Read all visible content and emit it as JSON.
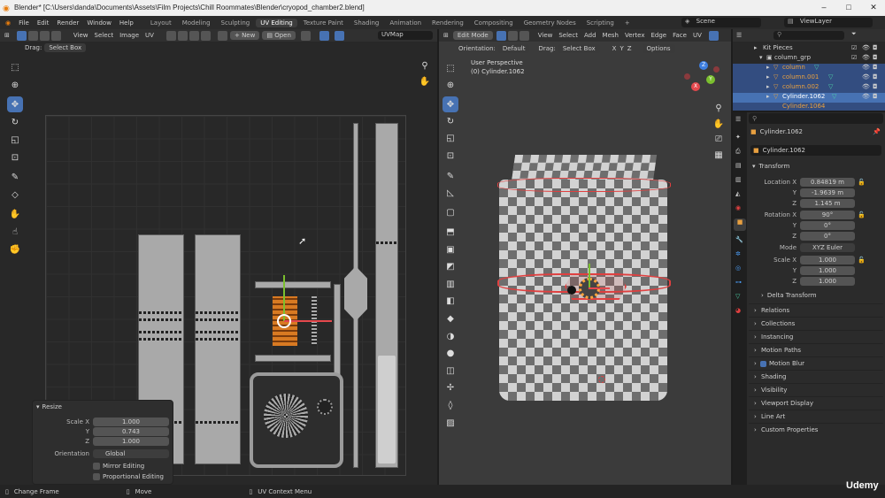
{
  "window": {
    "title": "Blender* [C:\\Users\\danda\\Documents\\Assets\\Film Projects\\Chill Roommates\\Blender\\cryopod_chamber2.blend]",
    "minimize": "–",
    "maximize": "□",
    "close": "✕"
  },
  "menus": [
    "File",
    "Edit",
    "Render",
    "Window",
    "Help"
  ],
  "workspaces": [
    "Layout",
    "Modeling",
    "Sculpting",
    "UV Editing",
    "Texture Paint",
    "Shading",
    "Animation",
    "Rendering",
    "Compositing",
    "Geometry Nodes",
    "Scripting"
  ],
  "workspace_add": "+",
  "scene": {
    "label": "Scene",
    "view_layer": "ViewLayer"
  },
  "uv_editor": {
    "header": {
      "view": "View",
      "select": "Select",
      "image": "Image",
      "uv": "UV",
      "new": "New",
      "open": "Open",
      "uvmap": "UVMap"
    },
    "drag_label": "Drag:",
    "drag_value": "Select Box",
    "resize_panel": {
      "title": "Resize",
      "scale_x_label": "Scale X",
      "scale_x": "1.000",
      "y_label": "Y",
      "y": "0.743",
      "z_label": "Z",
      "z": "1.000",
      "orientation_label": "Orientation",
      "orientation": "Global",
      "mirror": "Mirror Editing",
      "proportional": "Proportional Editing"
    }
  },
  "viewport": {
    "header": {
      "mode": "Edit Mode",
      "view": "View",
      "select": "Select",
      "add": "Add",
      "mesh": "Mesh",
      "vertex": "Vertex",
      "edge": "Edge",
      "face": "Face",
      "uv": "UV",
      "options": "Options"
    },
    "orientation_label": "Orientation:",
    "orientation": "Default",
    "drag_label": "Drag:",
    "drag_value": "Select Box",
    "axes": [
      "X",
      "Y",
      "Z"
    ],
    "info_line1": "User Perspective",
    "info_line2": "(0) Cylinder.1062",
    "gizmo": {
      "x": "X",
      "y": "Y",
      "z": "Z"
    }
  },
  "outliner": {
    "items": [
      {
        "name": "Kit Pieces"
      },
      {
        "name": "column_grp"
      },
      {
        "name": "column"
      },
      {
        "name": "column.001"
      },
      {
        "name": "column.002"
      },
      {
        "name": "Cylinder.1062"
      },
      {
        "name": "Cylinder.1064"
      }
    ]
  },
  "properties": {
    "object_name": "Cylinder.1062",
    "data_name": "Cylinder.1062",
    "transform_label": "Transform",
    "location_label": "Location X",
    "loc_x": "0.84819 m",
    "loc_y_label": "Y",
    "loc_y": "-1.9639 m",
    "loc_z_label": "Z",
    "loc_z": "1.145 m",
    "rotation_label": "Rotation X",
    "rot_x": "90°",
    "rot_y_label": "Y",
    "rot_y": "0°",
    "rot_z_label": "Z",
    "rot_z": "0°",
    "mode_label": "Mode",
    "mode": "XYZ Euler",
    "scale_label": "Scale X",
    "sc_x": "1.000",
    "sc_y_label": "Y",
    "sc_y": "1.000",
    "sc_z_label": "Z",
    "sc_z": "1.000",
    "delta": "Delta Transform",
    "sections": [
      "Relations",
      "Collections",
      "Instancing",
      "Motion Paths",
      "Motion Blur",
      "Shading",
      "Visibility",
      "Viewport Display",
      "Line Art",
      "Custom Properties"
    ]
  },
  "statusbar": {
    "change_frame": "Change Frame",
    "move": "Move",
    "uv_context": "UV Context Menu"
  },
  "watermark": "Udemy",
  "colors": {
    "accent": "#4772b3",
    "selection": "#334d80",
    "red_seam": "#e04040",
    "gizmo_x": "#e5484d",
    "gizmo_y": "#7bbf2e",
    "gizmo_z": "#3e7fe0"
  }
}
